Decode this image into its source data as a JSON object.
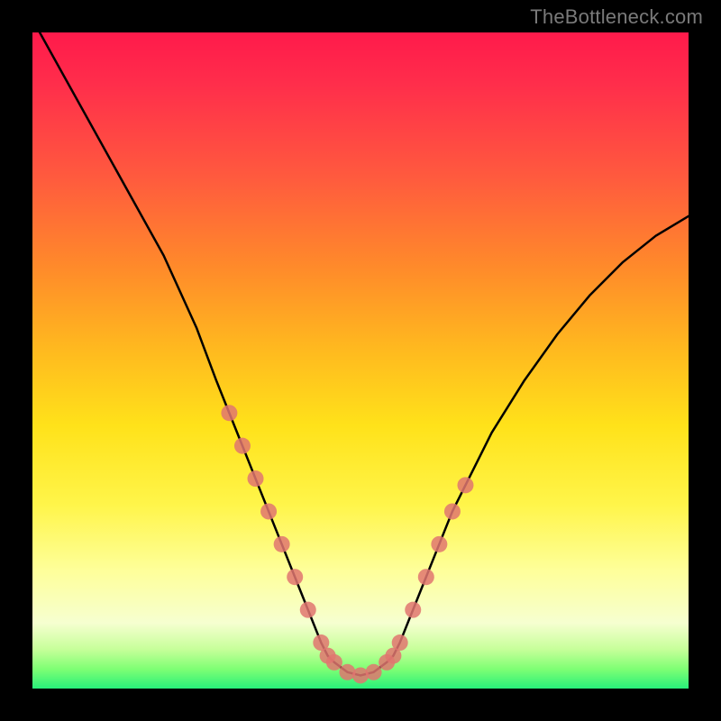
{
  "watermark": "TheBottleneck.com",
  "chart_data": {
    "type": "line",
    "title": "",
    "xlabel": "",
    "ylabel": "",
    "xlim": [
      0,
      100
    ],
    "ylim": [
      0,
      100
    ],
    "series": [
      {
        "name": "curve",
        "style": "line-black",
        "x": [
          0,
          5,
          10,
          15,
          20,
          25,
          28,
          30,
          32,
          34,
          36,
          38,
          40,
          42,
          44,
          45,
          46,
          48,
          50,
          52,
          54,
          55,
          56,
          58,
          60,
          62,
          64,
          66,
          70,
          75,
          80,
          85,
          90,
          95,
          100
        ],
        "y": [
          102,
          93,
          84,
          75,
          66,
          55,
          47,
          42,
          37,
          32,
          27,
          22,
          17,
          12,
          7,
          5,
          4,
          2.5,
          2,
          2.5,
          4,
          5,
          7,
          12,
          17,
          22,
          27,
          31,
          39,
          47,
          54,
          60,
          65,
          69,
          72
        ]
      },
      {
        "name": "left-dots",
        "style": "dots-salmon",
        "x": [
          30,
          32,
          34,
          36,
          38,
          40,
          42,
          44,
          45
        ],
        "y": [
          42,
          37,
          32,
          27,
          22,
          17,
          12,
          7,
          5
        ]
      },
      {
        "name": "right-dots",
        "style": "dots-salmon",
        "x": [
          55,
          56,
          58,
          60,
          62,
          64,
          66
        ],
        "y": [
          5,
          7,
          12,
          17,
          22,
          27,
          31
        ]
      },
      {
        "name": "bottom-dots",
        "style": "dots-salmon",
        "x": [
          46,
          48,
          50,
          52,
          54
        ],
        "y": [
          4,
          2.5,
          2,
          2.5,
          4
        ]
      }
    ],
    "colors": {
      "curve": "#000000",
      "dots": "#e07570",
      "gradient_top": "#ff1a4b",
      "gradient_bottom": "#28f07a"
    }
  }
}
